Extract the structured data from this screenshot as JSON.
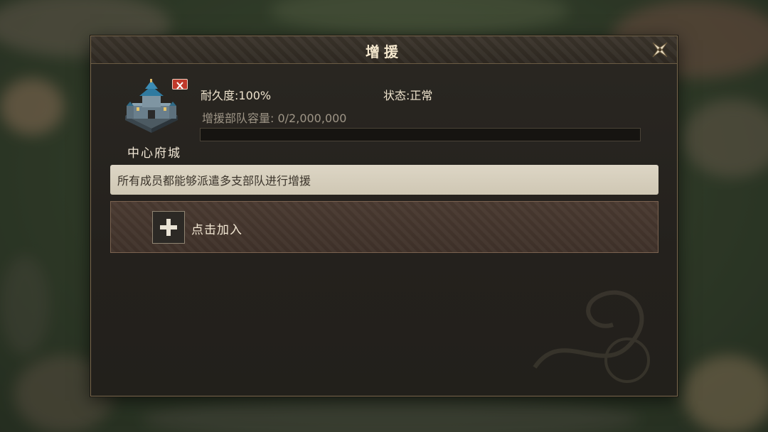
{
  "dialog": {
    "title": "增援",
    "close_icon": "close-x-icon"
  },
  "city": {
    "name": "中心府城",
    "icon": "castle-icon",
    "remove_icon": "remove-x-icon"
  },
  "stats": {
    "durability": "耐久度:100%",
    "status": "状态:正常",
    "capacity": "增援部队容量: 0/2,000,000",
    "capacity_fraction": 0
  },
  "notice": "所有成员都能够派遣多支部队进行增援",
  "join": {
    "label": "点击加入",
    "icon": "plus-icon"
  },
  "colors": {
    "accent_gold": "#f4e7cd",
    "remove_red": "#c0392b",
    "notice_bg": "#ddd6c5"
  }
}
